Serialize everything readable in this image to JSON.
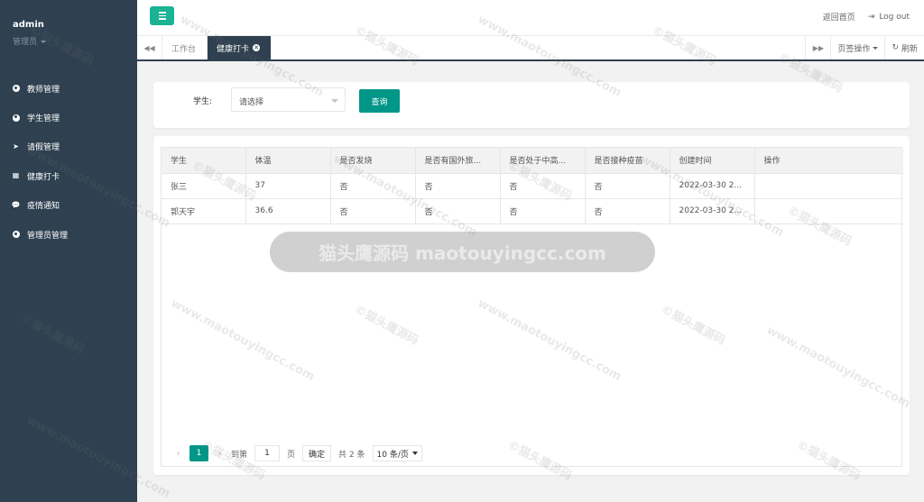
{
  "sidebar": {
    "user_name": "admin",
    "user_role": "管理员",
    "items": [
      {
        "label": "教师管理",
        "icon": "user-circle-icon"
      },
      {
        "label": "学生管理",
        "icon": "user-circle-icon"
      },
      {
        "label": "请假管理",
        "icon": "paper-plane-icon"
      },
      {
        "label": "健康打卡",
        "icon": "calendar-icon"
      },
      {
        "label": "疫情通知",
        "icon": "comment-icon"
      },
      {
        "label": "管理员管理",
        "icon": "user-circle-icon"
      }
    ]
  },
  "topbar": {
    "home_link": "返回首页",
    "logout_link": "Log out"
  },
  "tabs": {
    "items": [
      {
        "label": "工作台",
        "active": false
      },
      {
        "label": "健康打卡",
        "active": true
      }
    ],
    "tab_ops": "页签操作",
    "refresh": "刷新"
  },
  "search": {
    "label": "学生:",
    "placeholder": "请选择",
    "button": "查询"
  },
  "table": {
    "columns": [
      "学生",
      "体温",
      "是否发烧",
      "是否有国外旅...",
      "是否处于中高...",
      "是否接种疫苗",
      "创建时间",
      "操作"
    ],
    "rows": [
      [
        "张三",
        "37",
        "否",
        "否",
        "否",
        "否",
        "2022-03-30 2...",
        ""
      ],
      [
        "郭天宇",
        "36.6",
        "否",
        "否",
        "否",
        "否",
        "2022-03-30 2...",
        ""
      ]
    ]
  },
  "pager": {
    "current": "1",
    "goto_label": "到第",
    "page_input": "1",
    "page_unit": "页",
    "confirm": "确定",
    "total": "共 2 条",
    "per_page": "10 条/页"
  },
  "watermark": {
    "text_cn": "©猫头鹰源码",
    "text_url": "www.maotouyingcc.com",
    "banner": "猫头鹰源码 maotouyingcc.com"
  },
  "colors": {
    "sidebar_bg": "#2f4050",
    "accent": "#1ab394",
    "button": "#009688"
  }
}
